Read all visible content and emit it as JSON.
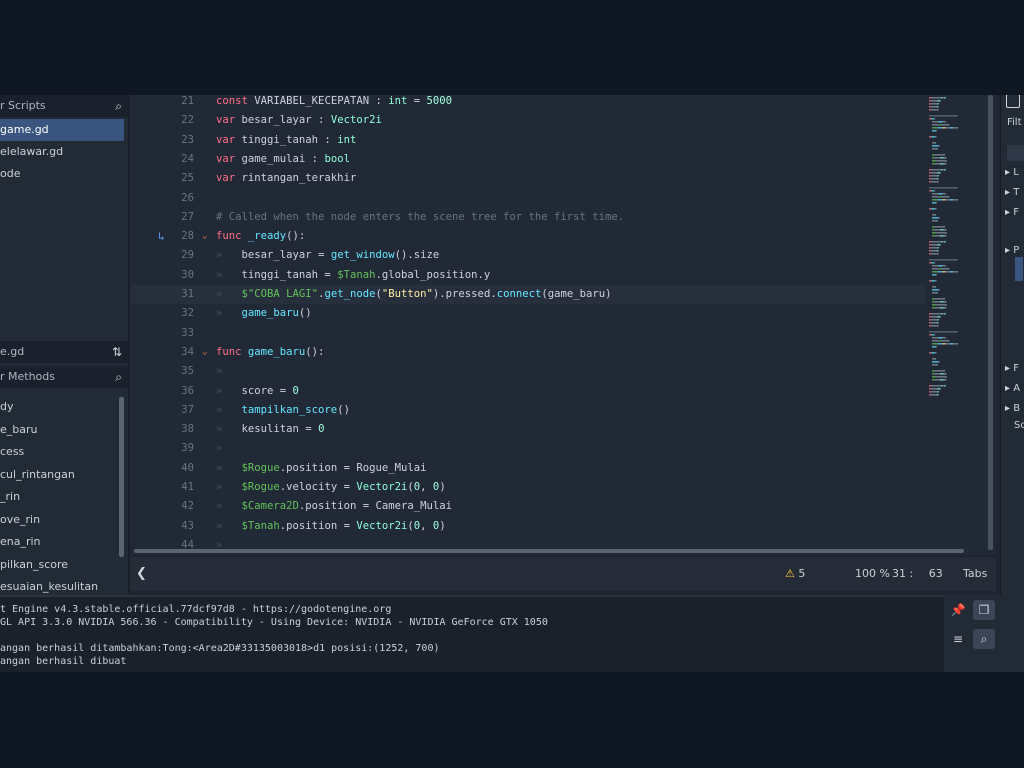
{
  "scripts_panel": {
    "header": "r Scripts",
    "items": [
      {
        "label": "game.gd",
        "active": true
      },
      {
        "label": "elelawar.gd",
        "active": false
      },
      {
        "label": "ode",
        "active": false
      }
    ]
  },
  "methods_panel": {
    "current_file": "e.gd",
    "filter_placeholder": "r Methods",
    "items": [
      "dy",
      "e_baru",
      "cess",
      "cul_rintangan",
      "_rin",
      "ove_rin",
      "ena_rin",
      "pilkan_score",
      "esuaian_kesulitan"
    ]
  },
  "editor": {
    "current_line": 31,
    "lines": [
      {
        "n": 21,
        "tokens": [
          [
            "kw",
            "const "
          ],
          [
            "plain",
            "VARIABEL_KECEPATAN : "
          ],
          [
            "ty",
            "int"
          ],
          [
            "plain",
            " = "
          ],
          [
            "num",
            "5000"
          ]
        ]
      },
      {
        "n": 22,
        "tokens": [
          [
            "kw",
            "var "
          ],
          [
            "plain",
            "besar_layar : "
          ],
          [
            "ty",
            "Vector2i"
          ]
        ]
      },
      {
        "n": 23,
        "tokens": [
          [
            "kw",
            "var "
          ],
          [
            "plain",
            "tinggi_tanah : "
          ],
          [
            "ty",
            "int"
          ]
        ]
      },
      {
        "n": 24,
        "tokens": [
          [
            "kw",
            "var "
          ],
          [
            "plain",
            "game_mulai : "
          ],
          [
            "ty",
            "bool"
          ]
        ]
      },
      {
        "n": 25,
        "tokens": [
          [
            "kw",
            "var "
          ],
          [
            "plain",
            "rintangan_terakhir"
          ]
        ]
      },
      {
        "n": 26,
        "tokens": []
      },
      {
        "n": 27,
        "tokens": [
          [
            "cm",
            "# Called when the node enters the scene tree for the first time."
          ]
        ]
      },
      {
        "n": 28,
        "fold": true,
        "marker": true,
        "tokens": [
          [
            "kw",
            "func "
          ],
          [
            "fn",
            "_ready"
          ],
          [
            "plain",
            "():"
          ]
        ]
      },
      {
        "n": 29,
        "indent": 1,
        "tokens": [
          [
            "plain",
            "besar_layar = "
          ],
          [
            "fn",
            "get_window"
          ],
          [
            "plain",
            "().size"
          ]
        ]
      },
      {
        "n": 30,
        "indent": 1,
        "tokens": [
          [
            "plain",
            "tinggi_tanah = "
          ],
          [
            "node",
            "$Tanah"
          ],
          [
            "plain",
            ".global_position.y"
          ]
        ]
      },
      {
        "n": 31,
        "indent": 1,
        "tokens": [
          [
            "node",
            "$\"COBA LAGI\""
          ],
          [
            "plain",
            "."
          ],
          [
            "fn",
            "get_node"
          ],
          [
            "plain",
            "("
          ],
          [
            "str",
            "\"Button\""
          ],
          [
            "plain",
            ")."
          ],
          [
            "plain",
            "pressed"
          ],
          [
            "plain",
            "."
          ],
          [
            "fn",
            "connect"
          ],
          [
            "plain",
            "(game_baru)"
          ]
        ]
      },
      {
        "n": 32,
        "indent": 1,
        "tokens": [
          [
            "fn",
            "game_baru"
          ],
          [
            "plain",
            "()"
          ]
        ]
      },
      {
        "n": 33,
        "tokens": []
      },
      {
        "n": 34,
        "fold": true,
        "tokens": [
          [
            "kw",
            "func "
          ],
          [
            "fn",
            "game_baru"
          ],
          [
            "plain",
            "():"
          ]
        ]
      },
      {
        "n": 35,
        "indent": 1,
        "tokens": []
      },
      {
        "n": 36,
        "indent": 1,
        "tokens": [
          [
            "plain",
            "score = "
          ],
          [
            "num",
            "0"
          ]
        ]
      },
      {
        "n": 37,
        "indent": 1,
        "tokens": [
          [
            "fn",
            "tampilkan_score"
          ],
          [
            "plain",
            "()"
          ]
        ]
      },
      {
        "n": 38,
        "indent": 1,
        "tokens": [
          [
            "plain",
            "kesulitan = "
          ],
          [
            "num",
            "0"
          ]
        ]
      },
      {
        "n": 39,
        "indent": 1,
        "tokens": []
      },
      {
        "n": 40,
        "indent": 1,
        "tokens": [
          [
            "node",
            "$Rogue"
          ],
          [
            "plain",
            ".position = Rogue_Mulai"
          ]
        ]
      },
      {
        "n": 41,
        "indent": 1,
        "tokens": [
          [
            "node",
            "$Rogue"
          ],
          [
            "plain",
            ".velocity = "
          ],
          [
            "ty",
            "Vector2i"
          ],
          [
            "plain",
            "("
          ],
          [
            "num",
            "0"
          ],
          [
            "plain",
            ", "
          ],
          [
            "num",
            "0"
          ],
          [
            "plain",
            ")"
          ]
        ]
      },
      {
        "n": 42,
        "indent": 1,
        "tokens": [
          [
            "node",
            "$Camera2D"
          ],
          [
            "plain",
            ".position = Camera_Mulai"
          ]
        ]
      },
      {
        "n": 43,
        "indent": 1,
        "tokens": [
          [
            "node",
            "$Tanah"
          ],
          [
            "plain",
            ".position = "
          ],
          [
            "ty",
            "Vector2i"
          ],
          [
            "plain",
            "("
          ],
          [
            "num",
            "0"
          ],
          [
            "plain",
            ", "
          ],
          [
            "num",
            "0"
          ],
          [
            "plain",
            ")"
          ]
        ]
      },
      {
        "n": 44,
        "indent": 1,
        "tokens": []
      }
    ]
  },
  "status": {
    "warnings": "5",
    "zoom": "100 %",
    "line": "31",
    "sep": ":",
    "column": "63",
    "indent_mode": "Tabs"
  },
  "right_dock": {
    "filter": "Filt",
    "rows": [
      "L",
      "T",
      "F",
      "P",
      "F",
      "A",
      "B"
    ],
    "footer": "Sc"
  },
  "output": {
    "lines": [
      "t Engine v4.3.stable.official.77dcf97d8 - https://godotengine.org",
      "GL API 3.3.0 NVIDIA 566.36 - Compatibility - Using Device: NVIDIA - NVIDIA GeForce GTX 1050",
      "",
      "angan berhasil ditambahkan:Tong:<Area2D#33135003018>d1 posisi:(1252, 700)",
      "angan berhasil dibuat"
    ]
  },
  "icons": {
    "search": "search-icon",
    "sort": "sort-icon",
    "warning": "warning-icon",
    "back": "chevron-left-icon",
    "pin": "pin-icon",
    "copy": "copy-icon",
    "filter": "filter-icon",
    "debug_marker": "breakpoint-connection-icon"
  },
  "colors": {
    "keyword": "#ff7085",
    "type": "#8effda",
    "function": "#66e6ff",
    "comment": "#6a7383",
    "string": "#ffeda1",
    "node_path": "#63c259",
    "selection": "#3a5580"
  }
}
